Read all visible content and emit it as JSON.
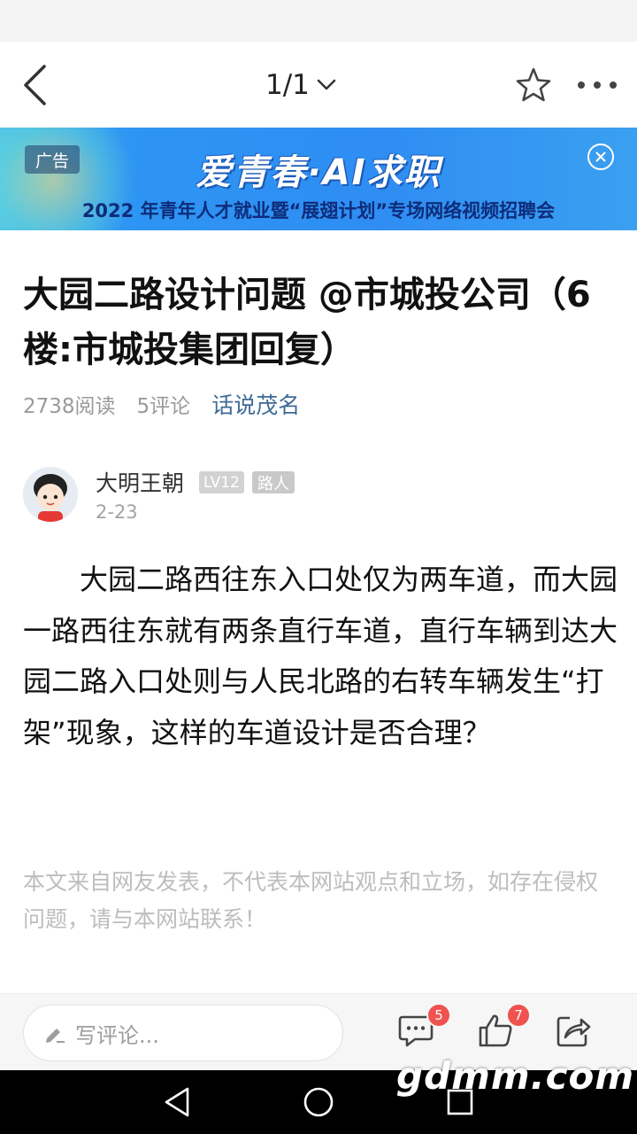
{
  "header": {
    "page_indicator": "1/1"
  },
  "ad": {
    "tag": "广告",
    "title": "爱青春·AI求职",
    "subtitle": "2022 年青年人才就业暨“展翅计划”专场网络视频招聘会"
  },
  "article": {
    "title": "大园二路设计问题 @市城投公司（6楼:市城投集团回复）",
    "reads": "2738阅读",
    "comments": "5评论",
    "forum": "话说茂名"
  },
  "author": {
    "name": "大明王朝",
    "level": "LV12",
    "role": "路人",
    "date": "2-23"
  },
  "post": {
    "body": "大园二路西往东入口处仅为两车道，而大园一路西往东就有两条直行车道，直行车辆到达大园二路入口处则与人民北路的右转车辆发生“打架”现象，这样的车道设计是否合理？",
    "disclaimer": "本文来自网友发表，不代表本网站观点和立场，如存在侵权问题，请与本网站联系！"
  },
  "bottom_bar": {
    "comment_placeholder": "写评论...",
    "comment_count": "5",
    "like_count": "7"
  },
  "watermark": "gdmm.com",
  "colors": {
    "forum_link": "#3f6a97",
    "badge": "#f0524f",
    "ad_blue": "#2f8df3"
  }
}
